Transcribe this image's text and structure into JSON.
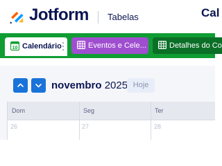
{
  "header": {
    "brand": "Jotform",
    "section": "Tabelas",
    "right_title": "Cal"
  },
  "tabs": [
    {
      "label": "Calendário",
      "icon": "calendar-icon",
      "active": true
    },
    {
      "label": "Eventos e Cele...",
      "icon": "table-icon",
      "active": false
    },
    {
      "label": "Detalhes do Co",
      "icon": "table-icon",
      "active": false
    }
  ],
  "calendar": {
    "month": "novembro",
    "year": "2025",
    "today_label": "Hoje",
    "calendar_icon_day": "10",
    "weekdays": [
      "Dom",
      "Seg",
      "Ter"
    ],
    "dates": [
      "26",
      "27",
      "28"
    ]
  },
  "colors": {
    "tabstrip": "#0f9d33",
    "tab_events": "#9f4ed0",
    "tab_details": "#0b6f27",
    "nav_button": "#1a73d9",
    "brand_text": "#0a1551"
  }
}
